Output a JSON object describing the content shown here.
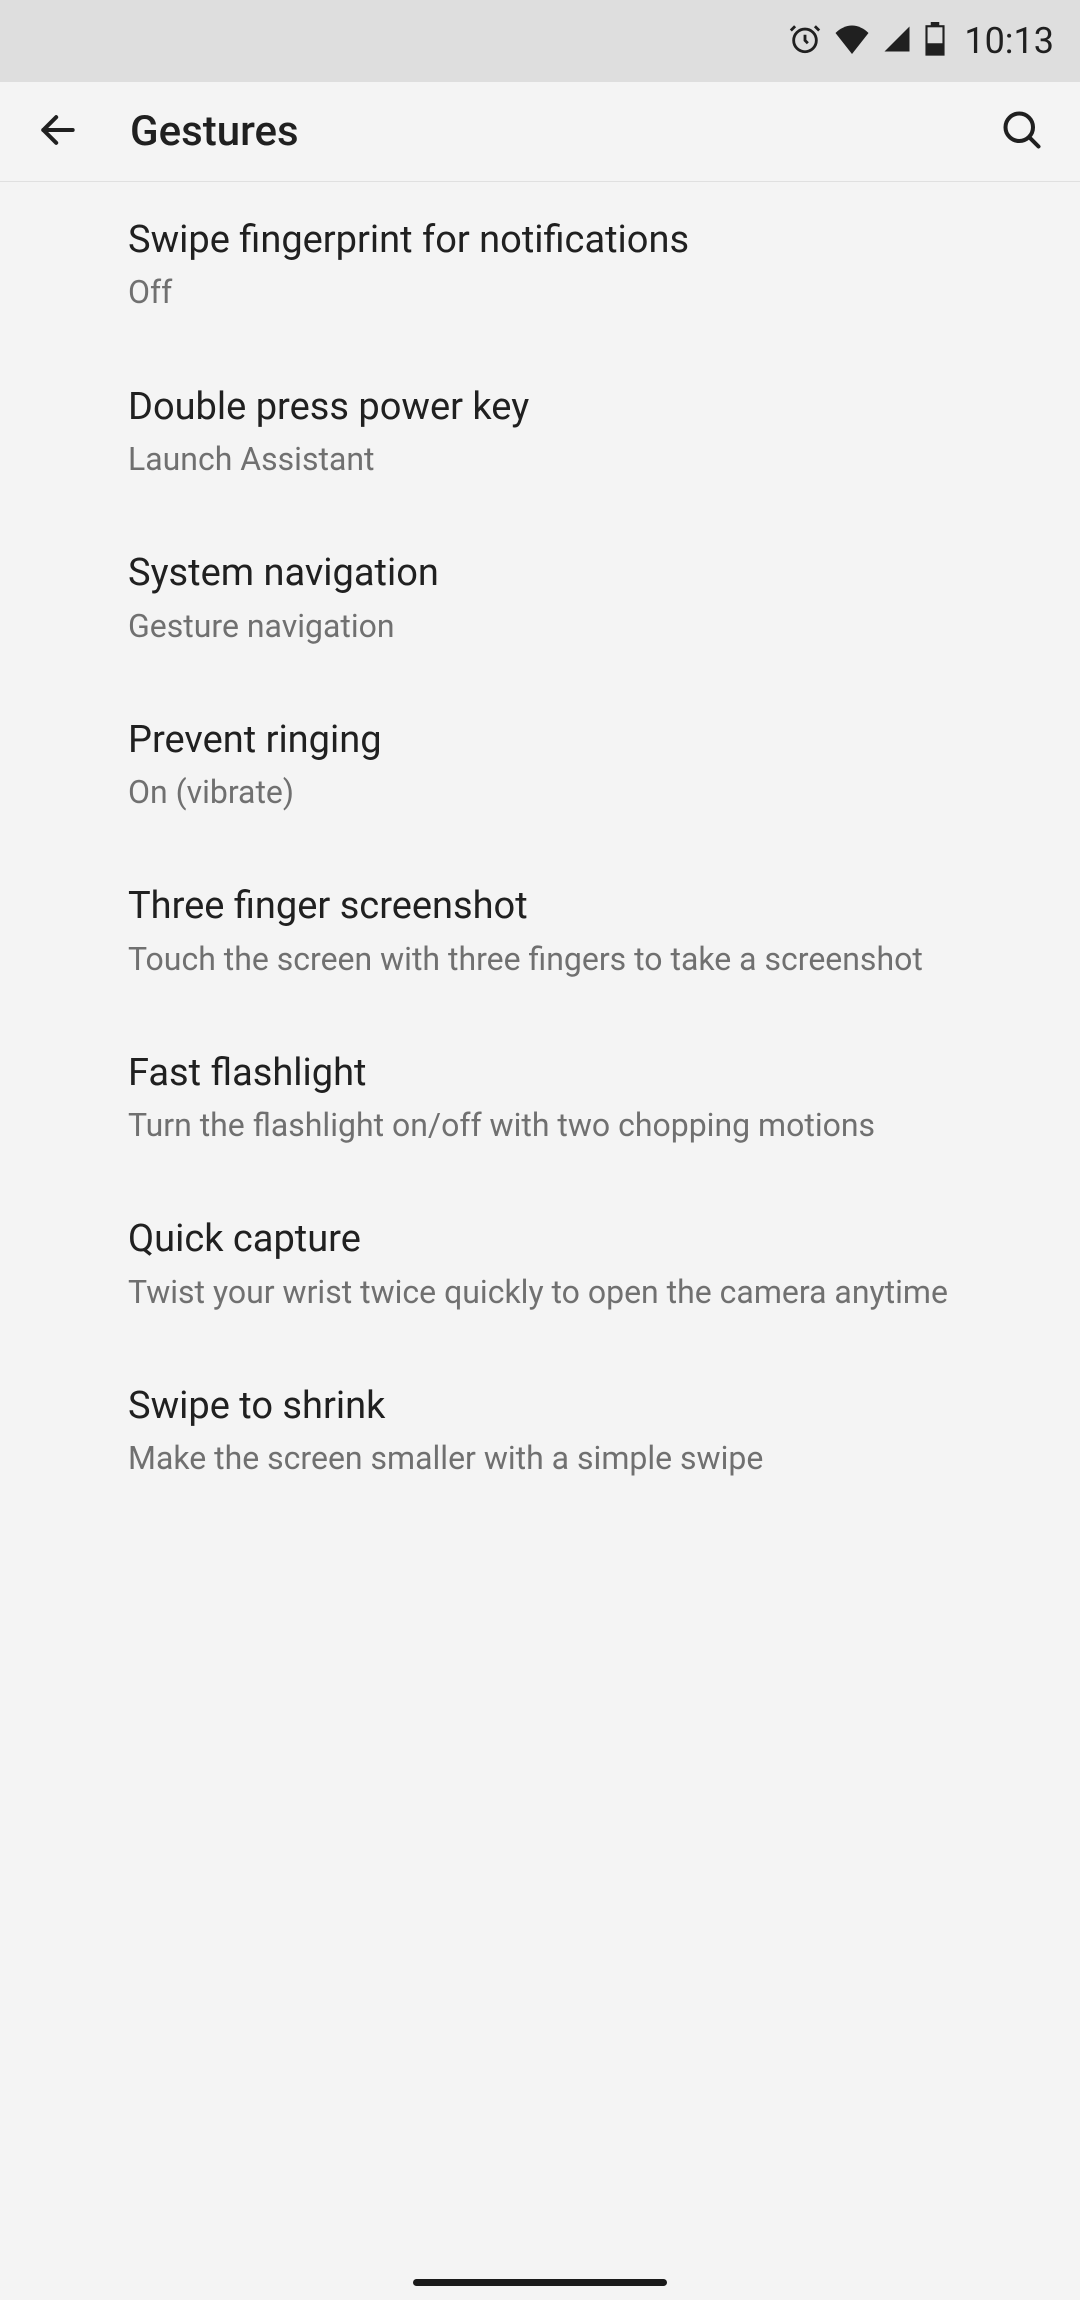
{
  "status": {
    "time": "10:13"
  },
  "header": {
    "title": "Gestures"
  },
  "settings": [
    {
      "title": "Swipe fingerprint for notifications",
      "subtitle": "Off"
    },
    {
      "title": "Double press power key",
      "subtitle": "Launch Assistant"
    },
    {
      "title": "System navigation",
      "subtitle": "Gesture navigation"
    },
    {
      "title": "Prevent ringing",
      "subtitle": "On (vibrate)"
    },
    {
      "title": "Three finger screenshot",
      "subtitle": "Touch the screen with three fingers to take a screenshot"
    },
    {
      "title": "Fast flashlight",
      "subtitle": "Turn the flashlight on/off with two chopping motions"
    },
    {
      "title": "Quick capture",
      "subtitle": "Twist your wrist twice quickly to open the camera anytime"
    },
    {
      "title": "Swipe to shrink",
      "subtitle": "Make the screen smaller with a simple swipe"
    }
  ]
}
